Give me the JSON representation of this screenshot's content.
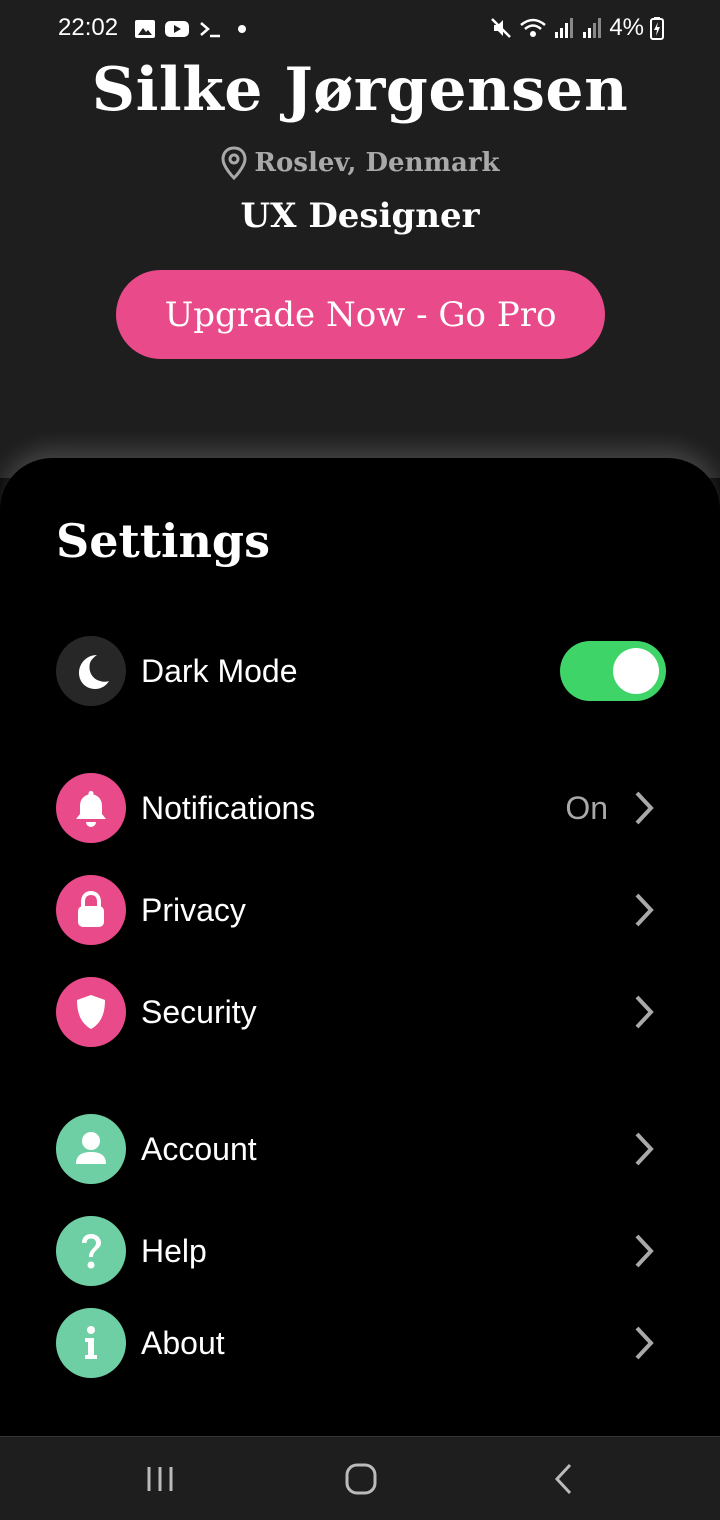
{
  "status_bar": {
    "time": "22:02",
    "battery": "4%",
    "icons_left": [
      "gallery-icon",
      "youtube-icon",
      "terminal-icon",
      "dot-icon"
    ],
    "icons_right": [
      "mute-icon",
      "wifi-icon",
      "signal-icon",
      "signal-icon",
      "battery-charging-icon"
    ]
  },
  "profile": {
    "name": "Silke Jørgensen",
    "location": "Roslev, Denmark",
    "title": "UX Designer",
    "upgrade_label": "Upgrade Now - Go Pro"
  },
  "settings": {
    "title": "Settings",
    "dark_mode": {
      "label": "Dark Mode",
      "enabled": true,
      "icon": "moon-icon"
    },
    "items": [
      {
        "label": "Notifications",
        "value": "On",
        "icon": "bell-icon",
        "color": "#e94a8a"
      },
      {
        "label": "Privacy",
        "value": "",
        "icon": "lock-icon",
        "color": "#e94a8a"
      },
      {
        "label": "Security",
        "value": "",
        "icon": "shield-icon",
        "color": "#e94a8a"
      },
      {
        "label": "Account",
        "value": "",
        "icon": "user-icon",
        "color": "#6fcfa4"
      },
      {
        "label": "Help",
        "value": "",
        "icon": "question-icon",
        "color": "#6fcfa4"
      },
      {
        "label": "About",
        "value": "",
        "icon": "info-icon",
        "color": "#6fcfa4"
      }
    ]
  },
  "colors": {
    "accent_pink": "#e94a8a",
    "accent_green": "#6fcfa4",
    "toggle_on": "#3fd468",
    "header_bg": "#1e1e1e"
  },
  "nav_bar": {
    "buttons": [
      "recent-apps-icon",
      "home-icon",
      "back-icon"
    ]
  }
}
